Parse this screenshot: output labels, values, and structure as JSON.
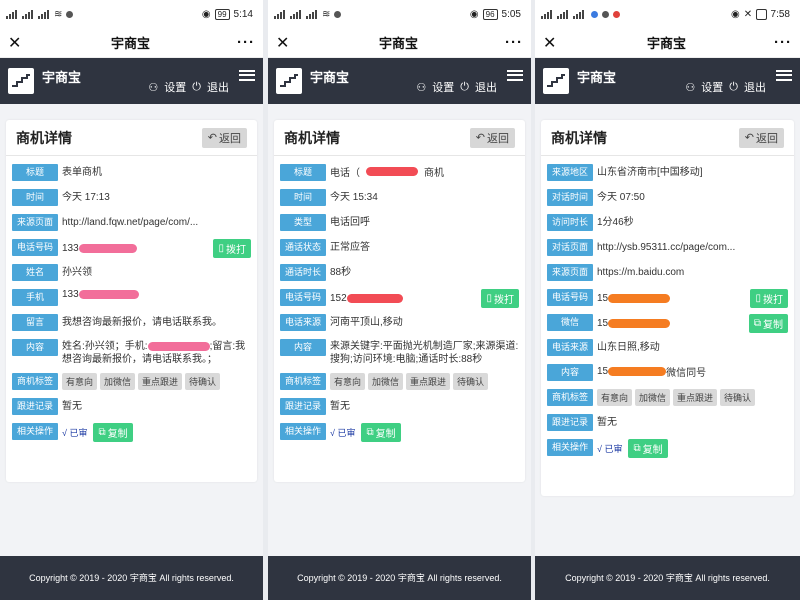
{
  "common": {
    "window_title": "宇商宝",
    "brand": "宇商宝",
    "settings_label": "设置",
    "logout_label": "退出",
    "card_title": "商机详情",
    "back_label": "返回",
    "dial_label": "拨打",
    "copy_label": "复制",
    "reviewed_label": "√ 已审",
    "footer": "Copyright © 2019 - 2020 宇商宝 All rights reserved."
  },
  "phones": [
    {
      "time": "5:14",
      "battery": "99",
      "rows": [
        {
          "label": "标题",
          "value": "表单商机"
        },
        {
          "label": "时间",
          "value": "今天 17:13"
        },
        {
          "label": "来源页面",
          "value": "http://land.fqw.net/page/com/..."
        },
        {
          "label": "电话号码",
          "value": "133"
        },
        {
          "label": "姓名",
          "value": "孙兴领"
        },
        {
          "label": "手机",
          "value": "133"
        },
        {
          "label": "留言",
          "value": "我想咨询最新报价，请电话联系我。"
        },
        {
          "label": "内容",
          "value_a": "姓名:孙兴领；手机:",
          "value_b": ";留言:我想咨询最新报价，请电话联系我。；"
        },
        {
          "label": "商机标签",
          "tags": [
            "有意向",
            "加微信",
            "重点跟进",
            "待确认"
          ]
        },
        {
          "label": "跟进记录",
          "value": "暂无"
        },
        {
          "label": "相关操作"
        }
      ]
    },
    {
      "time": "5:05",
      "battery": "96",
      "rows": [
        {
          "label": "标题",
          "value_a": "电话（",
          "value_b": "商机"
        },
        {
          "label": "时间",
          "value": "今天 15:34"
        },
        {
          "label": "类型",
          "value": "电话回呼"
        },
        {
          "label": "通话状态",
          "value": "正常应答"
        },
        {
          "label": "通话时长",
          "value": "88秒"
        },
        {
          "label": "电话号码",
          "value": "152"
        },
        {
          "label": "电话来源",
          "value": "河南平顶山,移动"
        },
        {
          "label": "内容",
          "value": "来源关键字:平面抛光机制造厂家;来源渠道:搜狗;访问环境:电脑;通话时长:88秒"
        },
        {
          "label": "商机标签",
          "tags": [
            "有意向",
            "加微信",
            "重点跟进",
            "待确认"
          ]
        },
        {
          "label": "跟进记录",
          "value": "暂无"
        },
        {
          "label": "相关操作"
        }
      ]
    },
    {
      "time": "7:58",
      "battery": "",
      "rows": [
        {
          "label": "来源地区",
          "value": "山东省济南市[中国移动]"
        },
        {
          "label": "对话时间",
          "value": "今天 07:50"
        },
        {
          "label": "访问时长",
          "value": "1分46秒"
        },
        {
          "label": "对话页面",
          "value": "http://ysb.95311.cc/page/com..."
        },
        {
          "label": "来源页面",
          "value": "https://m.baidu.com"
        },
        {
          "label": "电话号码",
          "value": "15"
        },
        {
          "label": "微信",
          "value": "15"
        },
        {
          "label": "电话来源",
          "value": "山东日照,移动"
        },
        {
          "label": "内容",
          "value_a": "15",
          "value_b": "微信同号"
        },
        {
          "label": "商机标签",
          "tags": [
            "有意向",
            "加微信",
            "重点跟进",
            "待确认"
          ]
        },
        {
          "label": "跟进记录",
          "value": "暂无"
        },
        {
          "label": "相关操作"
        }
      ]
    }
  ]
}
